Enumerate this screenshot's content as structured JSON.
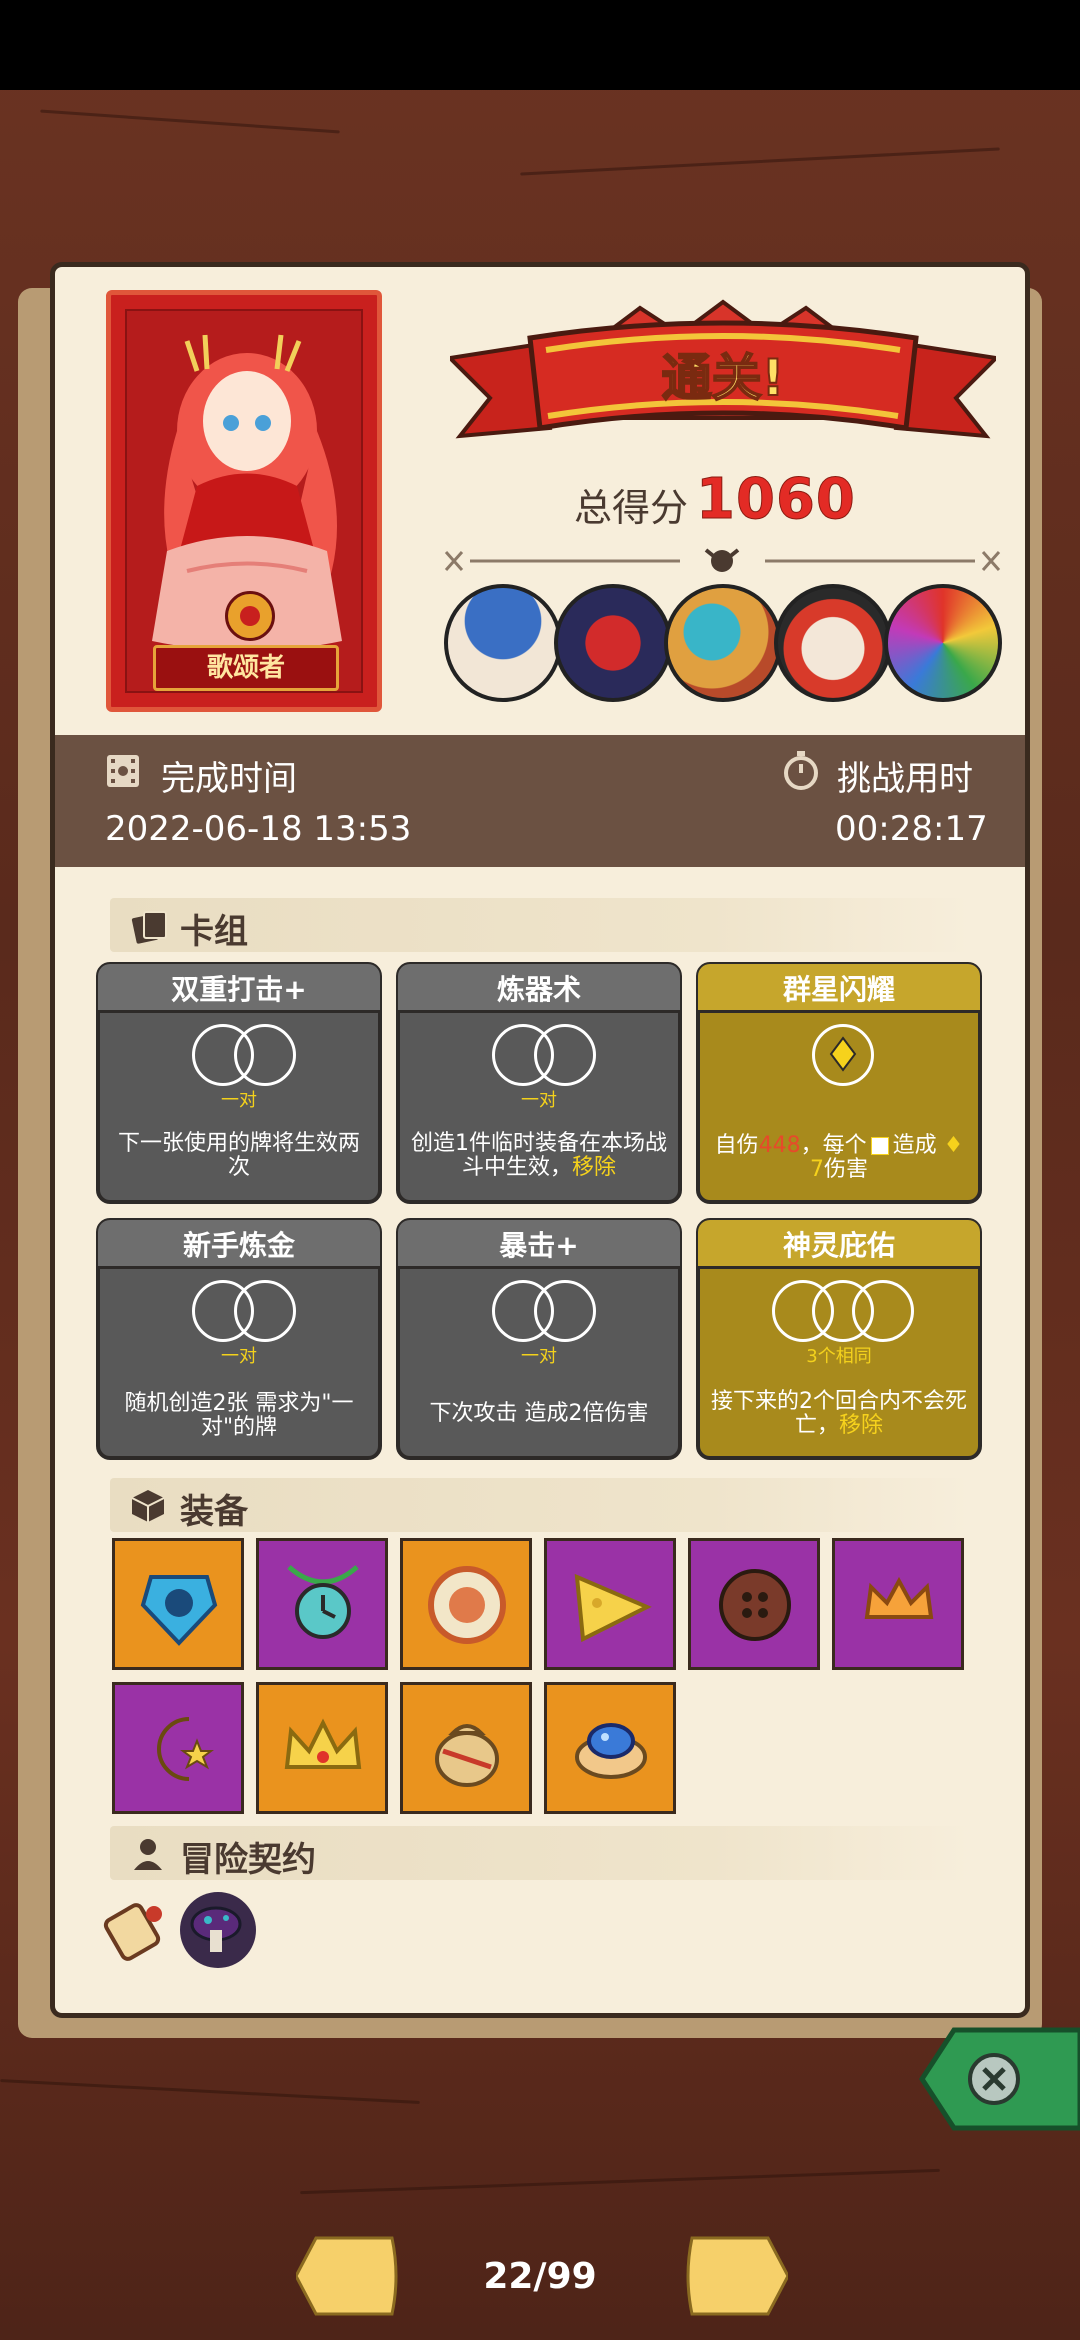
{
  "result": {
    "banner": "通关!",
    "score_label": "总得分",
    "score_value": "1060",
    "hero_name": "歌颂者"
  },
  "bosses": [
    "mushroom-elder",
    "box-robot",
    "fish-merchant",
    "demon-mask",
    "rainbow-beast"
  ],
  "info": {
    "finish_label": "完成时间",
    "finish_value": "2022-06-18 13:53",
    "duration_label": "挑战用时",
    "duration_value": "00:28:17"
  },
  "deck": {
    "title": "卡组",
    "cards": [
      {
        "name": "双重打击+",
        "tag": "一对",
        "desc": "下一张使用的牌将生效两次",
        "style": "gray"
      },
      {
        "name": "炼器术",
        "tag": "一对",
        "desc": "创造1件临时装备在本场战斗中生效，",
        "desc_hl": "移除",
        "style": "gray"
      },
      {
        "name": "群星闪耀",
        "tag": "",
        "desc_a": "自伤",
        "desc_red": "448",
        "desc_b": "，每个",
        "desc_c": "造成",
        "desc_d": "7",
        "desc_e": "伤害",
        "style": "gold"
      },
      {
        "name": "新手炼金",
        "tag": "一对",
        "desc": "随机创造2张 需求为\"一对\"的牌",
        "style": "gray"
      },
      {
        "name": "暴击+",
        "tag": "一对",
        "desc": "下次攻击 造成2倍伤害",
        "style": "gray"
      },
      {
        "name": "神灵庇佑",
        "tag": "3个相同",
        "desc": "接下来的2个回合内不会死亡，",
        "desc_hl": "移除",
        "style": "gold"
      }
    ]
  },
  "equipment": {
    "title": "装备",
    "items": [
      {
        "icon": "blue-shield-icon",
        "color": "orange"
      },
      {
        "icon": "clock-amulet-icon",
        "color": "purple"
      },
      {
        "icon": "ring-disc-icon",
        "color": "orange"
      },
      {
        "icon": "cheese-wedge-icon",
        "color": "purple"
      },
      {
        "icon": "button-icon",
        "color": "purple"
      },
      {
        "icon": "small-crown-icon",
        "color": "purple"
      },
      {
        "icon": "moon-star-wand-icon",
        "color": "purple"
      },
      {
        "icon": "gold-crown-icon",
        "color": "orange"
      },
      {
        "icon": "money-bag-icon",
        "color": "orange"
      },
      {
        "icon": "blue-mushroom-cookie-icon",
        "color": "orange"
      }
    ]
  },
  "contracts": {
    "title": "冒险契约",
    "items": [
      "scroll-icon",
      "dark-mushroom-icon"
    ]
  },
  "pager": {
    "text": "22/99"
  },
  "colors": {
    "accent_red": "#e32b25",
    "gold_card": "#a88a1c",
    "gray_card": "#595959",
    "equip_orange": "#ea931e",
    "equip_purple": "#9a32a6",
    "close_green": "#2f9a52"
  }
}
